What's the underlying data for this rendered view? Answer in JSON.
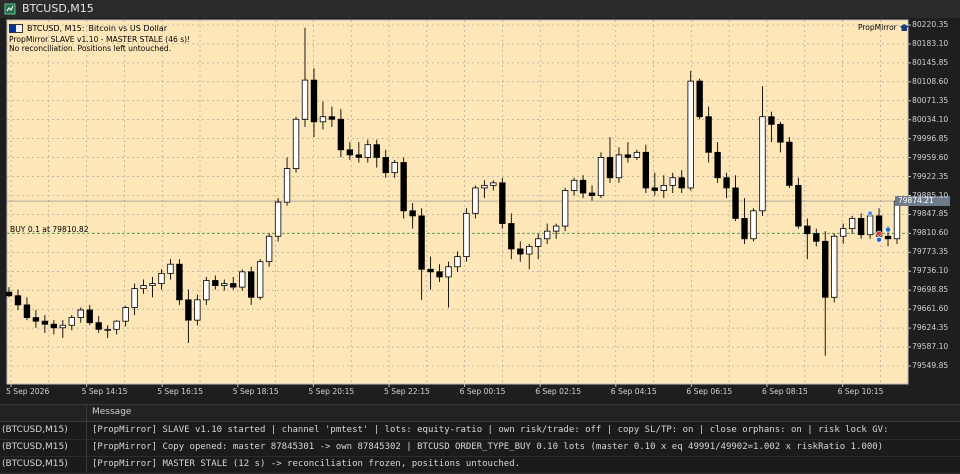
{
  "window": {
    "title": "BTCUSD,M15"
  },
  "chart": {
    "symbol": "BTCUSD, M15:",
    "description": "Bitcoin vs US Dollar",
    "ea_status_line1": "PropMirror SLAVE v1.10 - MASTER STALE (46 s)!",
    "ea_status_line2": "No reconciliation. Positions left untouched.",
    "ea_badge": "PropMirror",
    "buy_label": "BUY 0.1 at 79810.82",
    "buy_price": 79810.82,
    "current_price": "79874.21",
    "current_price_value": 79874.21,
    "price_labels": [
      "80220.35",
      "80183.10",
      "80145.85",
      "80108.60",
      "80071.35",
      "80034.10",
      "79996.85",
      "79959.60",
      "79922.35",
      "79885.10",
      "79847.85",
      "79810.60",
      "79773.35",
      "79736.10",
      "79698.85",
      "79661.60",
      "79624.35",
      "79587.10",
      "79549.85"
    ],
    "time_labels": [
      "5 Sep 2026",
      "5 Sep 14:15",
      "5 Sep 16:15",
      "5 Sep 18:15",
      "5 Sep 20:15",
      "5 Sep 22:15",
      "6 Sep 00:15",
      "6 Sep 02:15",
      "6 Sep 04:15",
      "6 Sep 06:15",
      "6 Sep 08:15",
      "6 Sep 10:15"
    ],
    "colors": {
      "background": "#fde7b8",
      "bull": "#ffffff",
      "bear": "#000000",
      "grid": "#9a9a9a",
      "buy_line": "#3c8c3c"
    },
    "candles": [
      {
        "o": 79695,
        "h": 79705,
        "l": 79685,
        "c": 79688
      },
      {
        "o": 79688,
        "h": 79700,
        "l": 79660,
        "c": 79670
      },
      {
        "o": 79670,
        "h": 79685,
        "l": 79640,
        "c": 79645
      },
      {
        "o": 79645,
        "h": 79660,
        "l": 79625,
        "c": 79638
      },
      {
        "o": 79638,
        "h": 79650,
        "l": 79615,
        "c": 79632
      },
      {
        "o": 79632,
        "h": 79640,
        "l": 79612,
        "c": 79625
      },
      {
        "o": 79625,
        "h": 79640,
        "l": 79605,
        "c": 79630
      },
      {
        "o": 79630,
        "h": 79650,
        "l": 79620,
        "c": 79645
      },
      {
        "o": 79645,
        "h": 79665,
        "l": 79635,
        "c": 79660
      },
      {
        "o": 79660,
        "h": 79670,
        "l": 79630,
        "c": 79635
      },
      {
        "o": 79635,
        "h": 79648,
        "l": 79615,
        "c": 79622
      },
      {
        "o": 79622,
        "h": 79630,
        "l": 79605,
        "c": 79622
      },
      {
        "o": 79622,
        "h": 79640,
        "l": 79612,
        "c": 79638
      },
      {
        "o": 79638,
        "h": 79668,
        "l": 79628,
        "c": 79665
      },
      {
        "o": 79665,
        "h": 79712,
        "l": 79650,
        "c": 79702
      },
      {
        "o": 79702,
        "h": 79720,
        "l": 79692,
        "c": 79708
      },
      {
        "o": 79708,
        "h": 79725,
        "l": 79685,
        "c": 79712
      },
      {
        "o": 79712,
        "h": 79740,
        "l": 79700,
        "c": 79732
      },
      {
        "o": 79732,
        "h": 79760,
        "l": 79720,
        "c": 79750
      },
      {
        "o": 79750,
        "h": 79760,
        "l": 79670,
        "c": 79680
      },
      {
        "o": 79680,
        "h": 79700,
        "l": 79595,
        "c": 79640
      },
      {
        "o": 79640,
        "h": 79690,
        "l": 79630,
        "c": 79680
      },
      {
        "o": 79680,
        "h": 79725,
        "l": 79670,
        "c": 79718
      },
      {
        "o": 79718,
        "h": 79728,
        "l": 79700,
        "c": 79708
      },
      {
        "o": 79708,
        "h": 79720,
        "l": 79698,
        "c": 79712
      },
      {
        "o": 79712,
        "h": 79725,
        "l": 79700,
        "c": 79705
      },
      {
        "o": 79705,
        "h": 79740,
        "l": 79698,
        "c": 79735
      },
      {
        "o": 79735,
        "h": 79745,
        "l": 79670,
        "c": 79685
      },
      {
        "o": 79685,
        "h": 79760,
        "l": 79680,
        "c": 79755
      },
      {
        "o": 79755,
        "h": 79810,
        "l": 79745,
        "c": 79805
      },
      {
        "o": 79805,
        "h": 79880,
        "l": 79795,
        "c": 79872
      },
      {
        "o": 79872,
        "h": 79960,
        "l": 79865,
        "c": 79938
      },
      {
        "o": 79938,
        "h": 80040,
        "l": 79930,
        "c": 80035
      },
      {
        "o": 80035,
        "h": 80215,
        "l": 80020,
        "c": 80112
      },
      {
        "o": 80112,
        "h": 80135,
        "l": 80000,
        "c": 80030
      },
      {
        "o": 80030,
        "h": 80070,
        "l": 80015,
        "c": 80040
      },
      {
        "o": 80040,
        "h": 80060,
        "l": 80020,
        "c": 80035
      },
      {
        "o": 80035,
        "h": 80055,
        "l": 79960,
        "c": 79975
      },
      {
        "o": 79975,
        "h": 79990,
        "l": 79955,
        "c": 79965
      },
      {
        "o": 79965,
        "h": 79990,
        "l": 79950,
        "c": 79960
      },
      {
        "o": 79960,
        "h": 79995,
        "l": 79950,
        "c": 79985
      },
      {
        "o": 79985,
        "h": 79995,
        "l": 79940,
        "c": 79960
      },
      {
        "o": 79960,
        "h": 79975,
        "l": 79920,
        "c": 79930
      },
      {
        "o": 79930,
        "h": 79955,
        "l": 79920,
        "c": 79950
      },
      {
        "o": 79950,
        "h": 79960,
        "l": 79840,
        "c": 79855
      },
      {
        "o": 79855,
        "h": 79870,
        "l": 79820,
        "c": 79845
      },
      {
        "o": 79845,
        "h": 79860,
        "l": 79680,
        "c": 79740
      },
      {
        "o": 79740,
        "h": 79765,
        "l": 79700,
        "c": 79735
      },
      {
        "o": 79735,
        "h": 79750,
        "l": 79715,
        "c": 79725
      },
      {
        "o": 79725,
        "h": 79755,
        "l": 79665,
        "c": 79745
      },
      {
        "o": 79745,
        "h": 79775,
        "l": 79735,
        "c": 79765
      },
      {
        "o": 79765,
        "h": 79860,
        "l": 79755,
        "c": 79850
      },
      {
        "o": 79850,
        "h": 79905,
        "l": 79840,
        "c": 79900
      },
      {
        "o": 79900,
        "h": 79915,
        "l": 79880,
        "c": 79905
      },
      {
        "o": 79905,
        "h": 79915,
        "l": 79895,
        "c": 79910
      },
      {
        "o": 79910,
        "h": 79920,
        "l": 79820,
        "c": 79830
      },
      {
        "o": 79830,
        "h": 79850,
        "l": 79760,
        "c": 79780
      },
      {
        "o": 79780,
        "h": 79795,
        "l": 79755,
        "c": 79770
      },
      {
        "o": 79770,
        "h": 79790,
        "l": 79740,
        "c": 79785
      },
      {
        "o": 79785,
        "h": 79810,
        "l": 79760,
        "c": 79800
      },
      {
        "o": 79800,
        "h": 79830,
        "l": 79790,
        "c": 79815
      },
      {
        "o": 79815,
        "h": 79830,
        "l": 79800,
        "c": 79825
      },
      {
        "o": 79825,
        "h": 79900,
        "l": 79815,
        "c": 79895
      },
      {
        "o": 79895,
        "h": 79920,
        "l": 79885,
        "c": 79915
      },
      {
        "o": 79915,
        "h": 79925,
        "l": 79880,
        "c": 79890
      },
      {
        "o": 79890,
        "h": 79905,
        "l": 79875,
        "c": 79885
      },
      {
        "o": 79885,
        "h": 79970,
        "l": 79880,
        "c": 79960
      },
      {
        "o": 79960,
        "h": 80000,
        "l": 79910,
        "c": 79920
      },
      {
        "o": 79920,
        "h": 79980,
        "l": 79910,
        "c": 79965
      },
      {
        "o": 79965,
        "h": 79990,
        "l": 79950,
        "c": 79960
      },
      {
        "o": 79960,
        "h": 79975,
        "l": 79955,
        "c": 79970
      },
      {
        "o": 79970,
        "h": 79985,
        "l": 79890,
        "c": 79900
      },
      {
        "o": 79900,
        "h": 79930,
        "l": 79885,
        "c": 79895
      },
      {
        "o": 79895,
        "h": 79925,
        "l": 79880,
        "c": 79905
      },
      {
        "o": 79905,
        "h": 79930,
        "l": 79890,
        "c": 79920
      },
      {
        "o": 79920,
        "h": 79935,
        "l": 79890,
        "c": 79900
      },
      {
        "o": 79900,
        "h": 80130,
        "l": 79895,
        "c": 80110
      },
      {
        "o": 80110,
        "h": 80115,
        "l": 80035,
        "c": 80040
      },
      {
        "o": 80040,
        "h": 80060,
        "l": 79950,
        "c": 79970
      },
      {
        "o": 79970,
        "h": 79990,
        "l": 79910,
        "c": 79920
      },
      {
        "o": 79920,
        "h": 79930,
        "l": 79880,
        "c": 79900
      },
      {
        "o": 79900,
        "h": 79925,
        "l": 79835,
        "c": 79840
      },
      {
        "o": 79840,
        "h": 79880,
        "l": 79790,
        "c": 79800
      },
      {
        "o": 79800,
        "h": 79860,
        "l": 79795,
        "c": 79855
      },
      {
        "o": 79855,
        "h": 80100,
        "l": 79845,
        "c": 80040
      },
      {
        "o": 80040,
        "h": 80050,
        "l": 79990,
        "c": 80025
      },
      {
        "o": 80025,
        "h": 80030,
        "l": 79970,
        "c": 79990
      },
      {
        "o": 79990,
        "h": 80000,
        "l": 79900,
        "c": 79905
      },
      {
        "o": 79905,
        "h": 79920,
        "l": 79820,
        "c": 79825
      },
      {
        "o": 79825,
        "h": 79840,
        "l": 79760,
        "c": 79810
      },
      {
        "o": 79810,
        "h": 79820,
        "l": 79785,
        "c": 79795
      },
      {
        "o": 79795,
        "h": 79815,
        "l": 79570,
        "c": 79685
      },
      {
        "o": 79685,
        "h": 79810,
        "l": 79675,
        "c": 79805
      },
      {
        "o": 79805,
        "h": 79830,
        "l": 79790,
        "c": 79820
      },
      {
        "o": 79820,
        "h": 79845,
        "l": 79810,
        "c": 79840
      },
      {
        "o": 79840,
        "h": 79850,
        "l": 79800,
        "c": 79808
      },
      {
        "o": 79808,
        "h": 79850,
        "l": 79800,
        "c": 79845
      },
      {
        "o": 79845,
        "h": 79860,
        "l": 79795,
        "c": 79805
      },
      {
        "o": 79805,
        "h": 79825,
        "l": 79785,
        "c": 79800
      },
      {
        "o": 79800,
        "h": 79880,
        "l": 79790,
        "c": 79874
      }
    ]
  },
  "toolbox": {
    "header": "Message",
    "rows": [
      {
        "source": "(BTCUSD,M15)",
        "message": "[PropMirror] SLAVE v1.10 started | channel 'pmtest' | lots: equity-ratio | own risk/trade: off | copy SL/TP: on | close orphans: on | risk lock GV:"
      },
      {
        "source": "(BTCUSD,M15)",
        "message": "[PropMirror] Copy opened: master 87845301 -> own 87845302 | BTCUSD ORDER_TYPE_BUY 0.10 lots (master 0.10 x eq 49991/49902=1.002 x riskRatio 1.000)"
      },
      {
        "source": "(BTCUSD,M15)",
        "message": "[PropMirror] MASTER STALE (12 s) -> reconciliation frozen, positions untouched."
      }
    ]
  }
}
